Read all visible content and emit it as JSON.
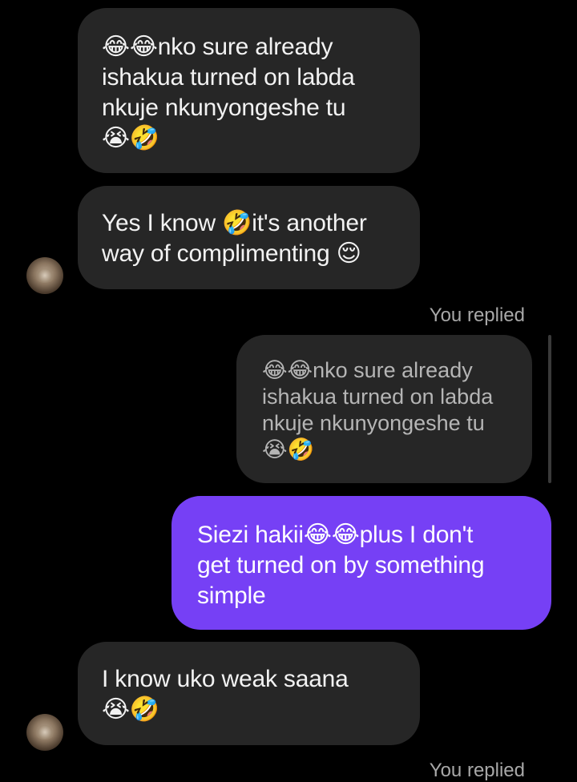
{
  "messages": {
    "msg1": {
      "text": "😂😂nko sure already\nishakua turned on labda\nnkuje nkunyongeshe tu\n😭🤣"
    },
    "msg2": {
      "text": "Yes I know 🤣it's another\nway of complimenting 😌"
    },
    "replied_label_1": "You replied",
    "quoted": {
      "text": "😂😂nko sure already\nishakua turned on labda\nnkuje nkunyongeshe tu\n😭🤣"
    },
    "outgoing": {
      "text": "Siezi hakii😂😂plus I don't\nget turned on by something\nsimple"
    },
    "msg5": {
      "text": "I know uko weak saana\n😭🤣"
    },
    "replied_label_2": "You replied"
  },
  "colors": {
    "background": "#000000",
    "incoming_bubble": "#262626",
    "outgoing_bubble": "#7640f5",
    "label": "#a8a8a8"
  }
}
